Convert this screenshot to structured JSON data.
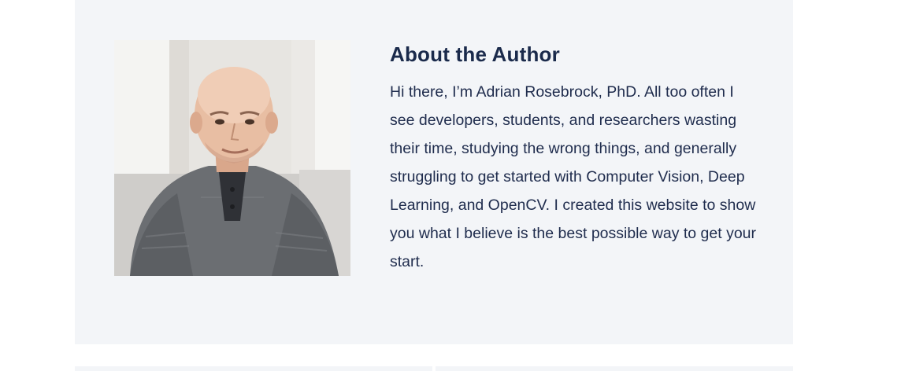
{
  "author": {
    "heading": "About the Author",
    "bio": "Hi there, I’m Adrian Rosebrock, PhD. All too often I see developers, students, and researchers wasting their time, studying the wrong things, and generally struggling to get started with Computer Vision, Deep Learning, and OpenCV. I created this website to show you what I believe is the best possible way to get your start.",
    "photo_icon": "author-portrait"
  },
  "colors": {
    "card_background": "#f3f5f8",
    "heading_text": "#1a2a4b",
    "body_text": "#1f2c4d"
  }
}
